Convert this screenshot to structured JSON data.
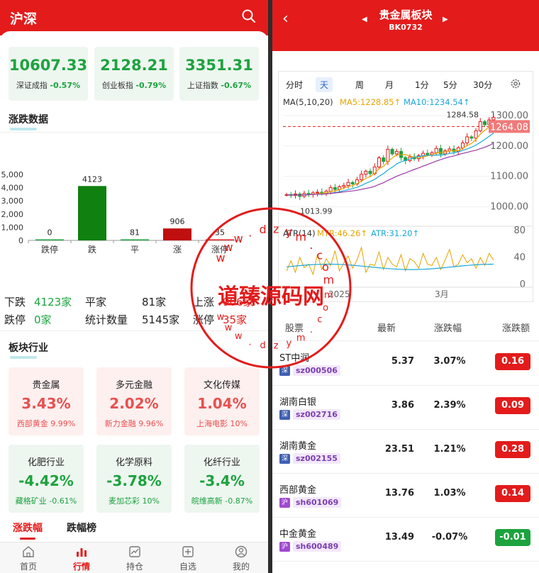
{
  "left": {
    "title": "沪深",
    "indices": [
      {
        "value": "10607.33",
        "name": "深证成指",
        "change": "-0.57%"
      },
      {
        "value": "2128.21",
        "name": "创业板指",
        "change": "-0.79%"
      },
      {
        "value": "3351.31",
        "name": "上证指数",
        "change": "-0.67%"
      }
    ],
    "updown_title": "涨跌数据",
    "chart_data": {
      "type": "bar",
      "categories": [
        "跌停",
        "跌",
        "平",
        "涨",
        "涨停"
      ],
      "values": [
        0,
        4123,
        81,
        906,
        35
      ],
      "colors": [
        "#1ca33e",
        "#108010",
        "#1ca33e",
        "#bf0f0f",
        "#e31b1b"
      ],
      "ylim": [
        0,
        5000
      ],
      "yticks": [
        "0",
        "1,000",
        "2,000",
        "3,000",
        "4,000",
        "5,000"
      ],
      "data_labels": [
        "0",
        "4123",
        "81",
        "906",
        "35"
      ]
    },
    "stats": {
      "down_label": "下跌",
      "down_value": "4123家",
      "flat_label": "平家",
      "flat_value": "81家",
      "up_label": "上涨",
      "up_value": "906家",
      "limitdown_label": "跌停",
      "limitdown_value": "0家",
      "total_label": "统计数量",
      "total_value": "5145家",
      "limitup_label": "涨停",
      "limitup_value": "35家"
    },
    "sector_title": "板块行业",
    "sectors": [
      {
        "name": "贵金属",
        "change": "3.43%",
        "leader": "西部黄金 9.99%",
        "dir": "up"
      },
      {
        "name": "多元金融",
        "change": "2.02%",
        "leader": "新力金融 9.96%",
        "dir": "up"
      },
      {
        "name": "文化传媒",
        "change": "1.04%",
        "leader": "上海电影 10%",
        "dir": "up"
      },
      {
        "name": "化肥行业",
        "change": "-4.42%",
        "leader": "藏格矿业 -0.61%",
        "dir": "down"
      },
      {
        "name": "化学原料",
        "change": "-3.78%",
        "leader": "麦加芯彩 10%",
        "dir": "down"
      },
      {
        "name": "化纤行业",
        "change": "-3.4%",
        "leader": "皖维高新 -0.87%",
        "dir": "down"
      }
    ],
    "tabs": [
      "涨跌幅",
      "跌幅榜"
    ],
    "nav": [
      {
        "label": "首页",
        "icon": "home-icon"
      },
      {
        "label": "行情",
        "icon": "market-icon"
      },
      {
        "label": "持仓",
        "icon": "position-icon"
      },
      {
        "label": "自选",
        "icon": "watchlist-icon"
      },
      {
        "label": "我的",
        "icon": "profile-icon"
      }
    ]
  },
  "right": {
    "title": "贵金属板块",
    "code": "BK0732",
    "timeframes": [
      "分时",
      "天",
      "周",
      "月",
      "1分",
      "5分",
      "30分"
    ],
    "active_timeframe": "天",
    "ma_label": "MA(5,10,20)",
    "ma5": "MA5:1228.85↑",
    "ma10": "MA10:1234.54↑",
    "price_levels": [
      "1300.00",
      "1200.00",
      "1100.00",
      "1000.00"
    ],
    "current_price": "1264.08",
    "high_mark": "1284.58",
    "low_mark": "1013.99",
    "atr_label": "ATR(14)",
    "mtr": "MTR:46.26↑",
    "atr": "ATR:31.20↑",
    "atr_levels": [
      "80",
      "40",
      "0"
    ],
    "x_labels": [
      "2025",
      "3月"
    ],
    "table_headers": [
      "股票",
      "最新",
      "涨跌幅",
      "涨跌额"
    ],
    "stocks": [
      {
        "name": "ST中润",
        "market": "深",
        "code": "sz000506",
        "price": "5.37",
        "pct": "3.07%",
        "chg": "0.16",
        "dir": "up"
      },
      {
        "name": "湖南白银",
        "market": "深",
        "code": "sz002716",
        "price": "3.86",
        "pct": "2.39%",
        "chg": "0.09",
        "dir": "up"
      },
      {
        "name": "湖南黄金",
        "market": "深",
        "code": "sz002155",
        "price": "23.51",
        "pct": "1.21%",
        "chg": "0.28",
        "dir": "up"
      },
      {
        "name": "西部黄金",
        "market": "沪",
        "code": "sh601069",
        "price": "13.76",
        "pct": "1.03%",
        "chg": "0.14",
        "dir": "up"
      },
      {
        "name": "中金黄金",
        "market": "沪",
        "code": "sh600489",
        "price": "13.49",
        "pct": "-0.07%",
        "chg": "-0.01",
        "dir": "down"
      }
    ]
  },
  "watermark": {
    "text": "道臻源码网",
    "url_letters": "www.dzym.com"
  },
  "colors": {
    "brand_red": "#e31b1b",
    "up_red": "#e31b1b",
    "down_green": "#1ca33e",
    "sz_badge": "#3f5fb0",
    "sh_badge": "#a04ad0"
  }
}
